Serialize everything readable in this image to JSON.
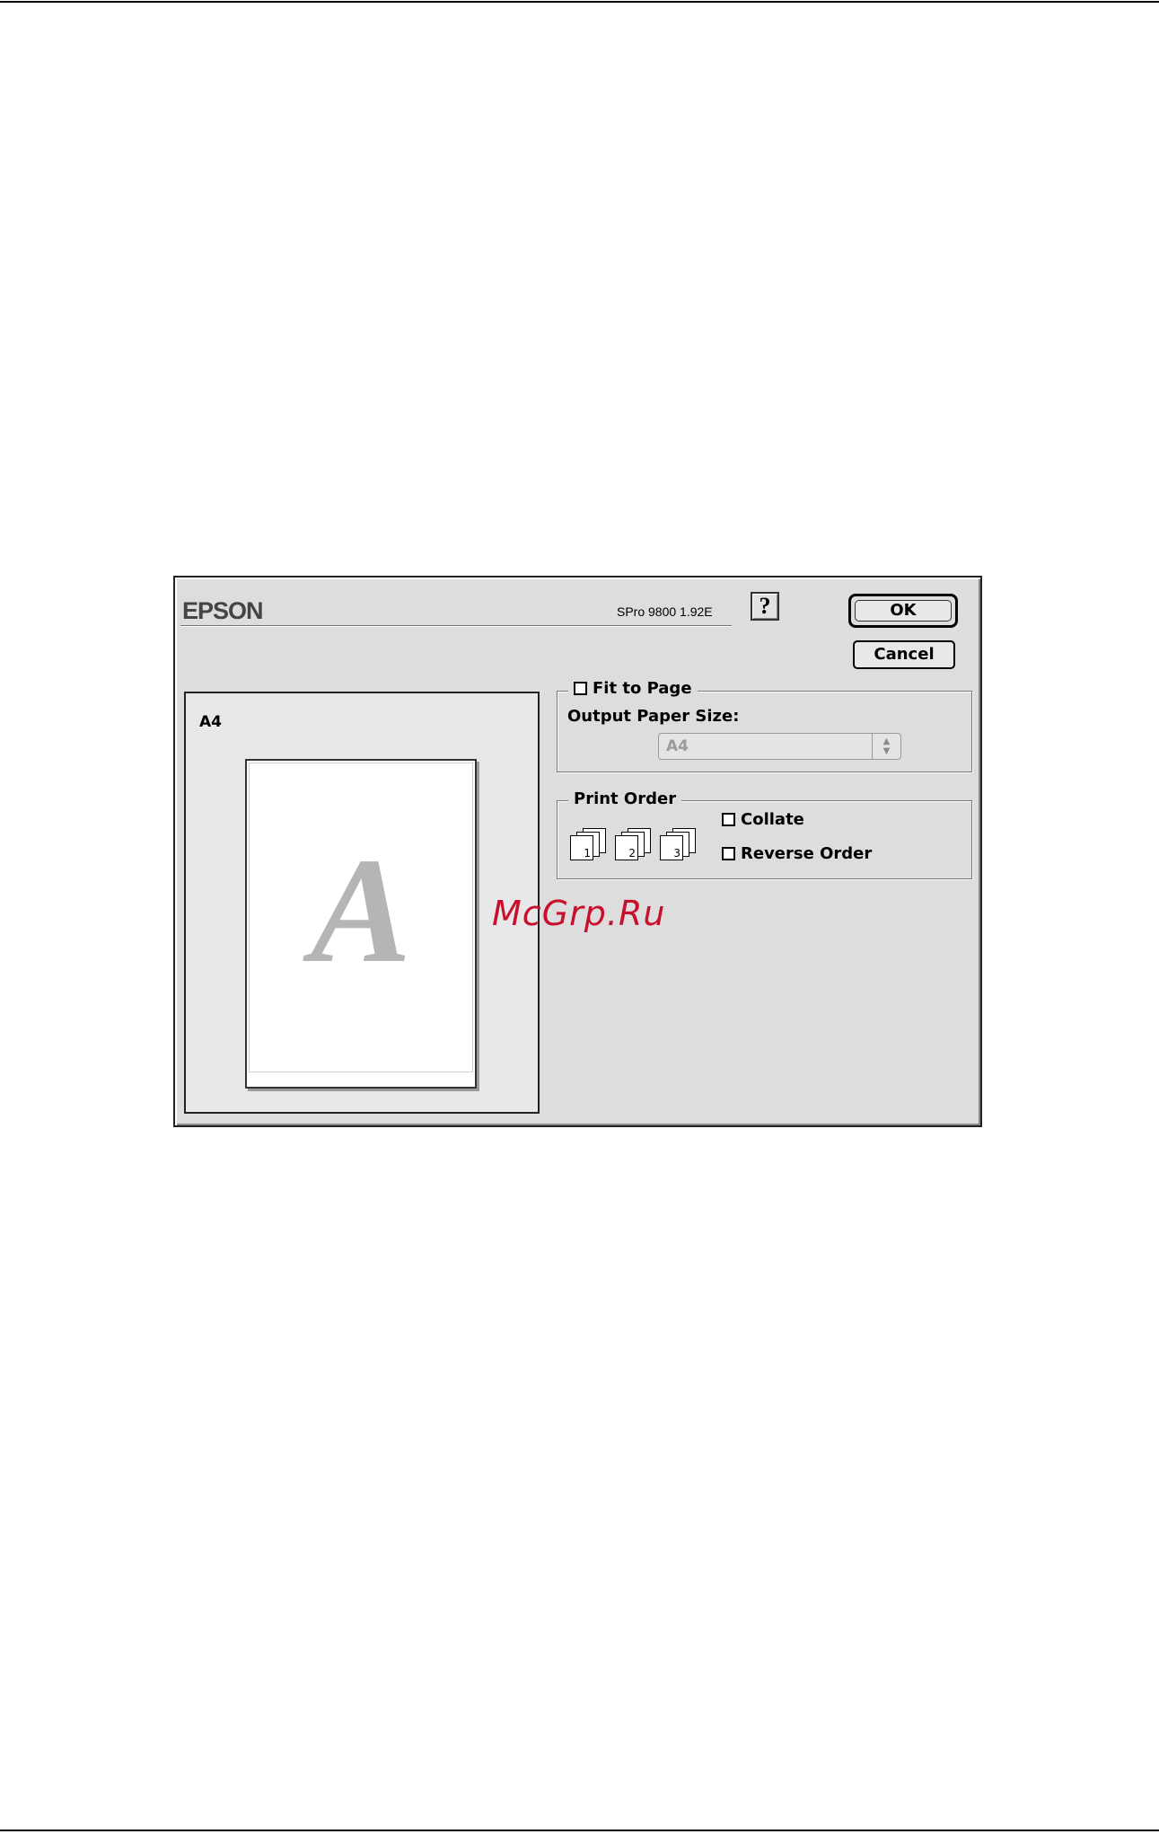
{
  "dialog": {
    "brand": "EPSON",
    "model_version": "SPro 9800 1.92E",
    "help_label": "?",
    "ok_label": "OK",
    "cancel_label": "Cancel"
  },
  "preview": {
    "paper_label": "A4",
    "glyph": "A"
  },
  "fit_to_page": {
    "label": "Fit to Page",
    "checked": false,
    "output_size_label": "Output Paper Size:",
    "output_size_value": "A4",
    "enabled": false
  },
  "print_order": {
    "title": "Print Order",
    "icons": [
      {
        "name": "collate-stack-1-icon",
        "number": "1"
      },
      {
        "name": "collate-stack-2-icon",
        "number": "2"
      },
      {
        "name": "collate-stack-3-icon",
        "number": "3"
      }
    ],
    "collate_label": "Collate",
    "collate_checked": false,
    "reverse_label": "Reverse Order",
    "reverse_checked": false
  },
  "watermark": "McGrp.Ru",
  "colors": {
    "dialog_bg": "#dddddd",
    "watermark": "#c8102e",
    "disabled_text": "#9a9a9a"
  }
}
